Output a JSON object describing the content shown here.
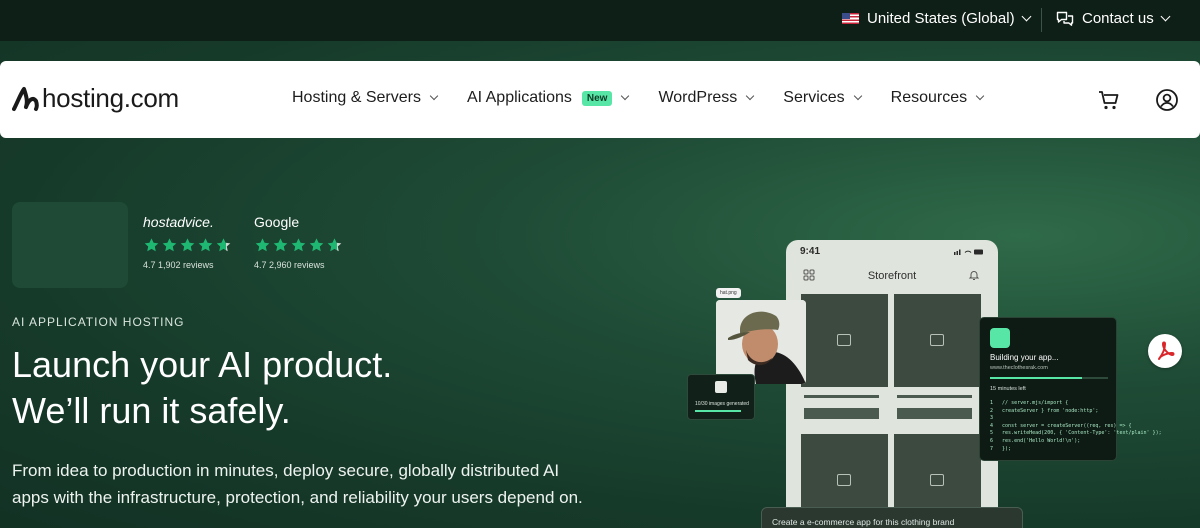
{
  "topbar": {
    "region_label": "United States (Global)",
    "contact_label": "Contact us"
  },
  "nav": {
    "logo_text": "hosting.com",
    "items": [
      {
        "label": "Hosting & Servers"
      },
      {
        "label": "AI Applications",
        "badge": "New"
      },
      {
        "label": "WordPress"
      },
      {
        "label": "Services"
      },
      {
        "label": "Resources"
      }
    ]
  },
  "ratings": [
    {
      "brand_prefix": "host",
      "brand_suffix": "advice.",
      "score": "4.7",
      "reviews": "1,902 reviews",
      "stars": 4.7
    },
    {
      "brand": "Google",
      "score": "4.7",
      "reviews": "2,960 reviews",
      "stars": 4.7
    }
  ],
  "hero": {
    "eyebrow": "AI APPLICATION HOSTING",
    "headline_line1": "Launch your AI product.",
    "headline_line2": "We’ll run it safely.",
    "subtext": "From idea to production in minutes, deploy secure, globally distributed AI apps with the infrastructure, protection, and reliability your users depend on."
  },
  "mockup": {
    "phone_time": "9:41",
    "phone_title": "Storefront",
    "photo_tag": "hat.png",
    "gen_text": "10/30 images generated",
    "build_title": "Building your app...",
    "build_url": "www.theclothesrak.com",
    "build_eta": "15 minutes left",
    "build_progress": 0.78,
    "code": "1   // server.mjs/import {\n2   createServer } from 'node:http';\n3\n4   const server = createServer((req, res) => {\n5   res.writeHead(200, { 'Content-Type': 'text/plain' });\n6   res.end('Hello World!\\n');\n7   });",
    "prompt": "Create a e-commerce app for this clothing brand"
  },
  "colors": {
    "accent": "#58e6a6",
    "star": "#1fb872",
    "nav_bg": "#ffffff",
    "topbar_bg": "#0e1f17"
  }
}
